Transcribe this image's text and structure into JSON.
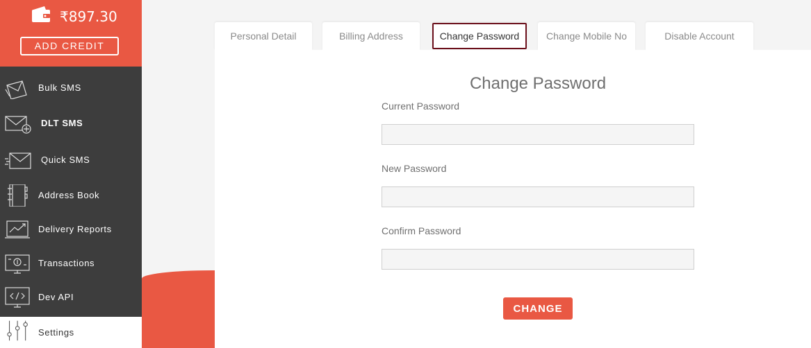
{
  "wallet": {
    "balance": "₹897.30",
    "add_credit_label": "ADD CREDIT"
  },
  "sidebar": {
    "items": [
      {
        "label": "Bulk SMS",
        "icon": "bulk-sms-icon"
      },
      {
        "label": "DLT SMS",
        "icon": "dlt-sms-icon"
      },
      {
        "label": "Quick SMS",
        "icon": "quick-sms-icon"
      },
      {
        "label": "Address Book",
        "icon": "address-book-icon"
      },
      {
        "label": "Delivery Reports",
        "icon": "delivery-reports-icon"
      },
      {
        "label": "Transactions",
        "icon": "transactions-icon"
      },
      {
        "label": "Dev API",
        "icon": "code-icon"
      },
      {
        "label": "Settings",
        "icon": "sliders-icon"
      }
    ],
    "active": "Settings"
  },
  "tabs": [
    {
      "label": "Personal Detail"
    },
    {
      "label": "Billing Address"
    },
    {
      "label": "Change Password"
    },
    {
      "label": "Change Mobile No"
    },
    {
      "label": "Disable Account"
    }
  ],
  "active_tab": "Change Password",
  "form": {
    "title": "Change Password",
    "fields": [
      {
        "label": "Current Password",
        "value": "",
        "placeholder": ""
      },
      {
        "label": "New Password",
        "value": "",
        "placeholder": ""
      },
      {
        "label": "Confirm Password",
        "value": "",
        "placeholder": ""
      }
    ],
    "submit_label": "CHANGE"
  },
  "colors": {
    "accent": "#e95843",
    "sidebar_bg": "#3d3d3d",
    "active_tab_border": "#6b0f1a"
  }
}
